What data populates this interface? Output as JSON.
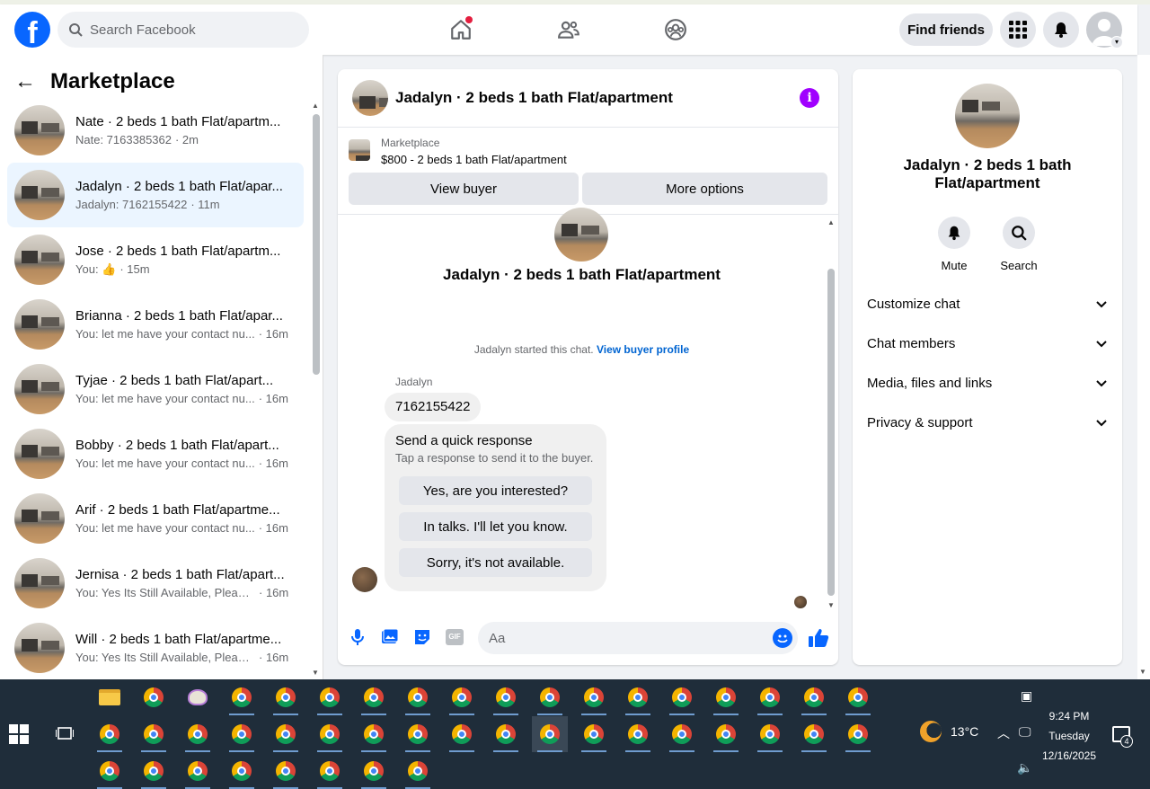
{
  "topbar": {
    "logo_letter": "f",
    "search_placeholder": "Search Facebook",
    "find_friends": "Find friends"
  },
  "left": {
    "title": "Marketplace",
    "conversations": [
      {
        "name": "Nate · 2 beds 1 bath Flat/apartm...",
        "preview": "Nate: 7163385362",
        "time": "· 2m",
        "active": false
      },
      {
        "name": "Jadalyn · 2 beds 1 bath Flat/apar...",
        "preview": "Jadalyn: 7162155422",
        "time": "· 11m",
        "active": true
      },
      {
        "name": "Jose · 2 beds 1 bath Flat/apartm...",
        "preview": "You: 👍",
        "time": "· 15m",
        "active": false
      },
      {
        "name": "Brianna · 2 beds 1 bath Flat/apar...",
        "preview": "You: let me have your contact nu...",
        "time": "· 16m",
        "active": false
      },
      {
        "name": "Tyjae · 2 beds 1 bath Flat/apart...",
        "preview": "You: let me have your contact nu...",
        "time": "· 16m",
        "active": false
      },
      {
        "name": "Bobby · 2 beds 1 bath Flat/apart...",
        "preview": "You: let me have your contact nu...",
        "time": "· 16m",
        "active": false
      },
      {
        "name": "Arif · 2 beds 1 bath Flat/apartme...",
        "preview": "You: let me have your contact nu...",
        "time": "· 16m",
        "active": false
      },
      {
        "name": "Jernisa · 2 beds 1 bath Flat/apart...",
        "preview": "You: Yes Its Still Available, Please ...",
        "time": "· 16m",
        "active": false
      },
      {
        "name": "Will · 2 beds 1 bath Flat/apartme...",
        "preview": "You: Yes Its Still Available, Please ...",
        "time": "· 16m",
        "active": false
      }
    ]
  },
  "chat": {
    "title": "Jadalyn · 2 beds 1 bath Flat/apartment",
    "info_letter": "i",
    "listing_label": "Marketplace",
    "listing_price": "$800 - 2 beds 1 bath Flat/apartment",
    "view_buyer": "View buyer",
    "more_options": "More options",
    "header_title": "Jadalyn · 2 beds 1 bath Flat/apartment",
    "started_text": "Jadalyn started this chat.",
    "view_profile": "View buyer profile",
    "sender": "Jadalyn",
    "message": "7162155422",
    "quick_title": "Send a quick response",
    "quick_subtitle": "Tap a response to send it to the buyer.",
    "quick_responses": [
      "Yes, are you interested?",
      "In talks. I'll let you know.",
      "Sorry, it's not available."
    ],
    "composer_placeholder": "Aa",
    "gif_label": "GIF"
  },
  "right": {
    "title": "Jadalyn · 2 beds 1 bath Flat/apartment",
    "mute": "Mute",
    "search": "Search",
    "sections": [
      "Customize chat",
      "Chat members",
      "Media, files and links",
      "Privacy & support"
    ]
  },
  "taskbar": {
    "temperature": "13°C",
    "time": "9:24 PM",
    "day": "Tuesday",
    "date": "12/16/2025",
    "notification_count": "4"
  },
  "colors": {
    "facebook_blue": "#0866ff",
    "active_item": "#ebf5ff",
    "info_purple": "#a000ff",
    "taskbar": "#1f2d3a"
  }
}
